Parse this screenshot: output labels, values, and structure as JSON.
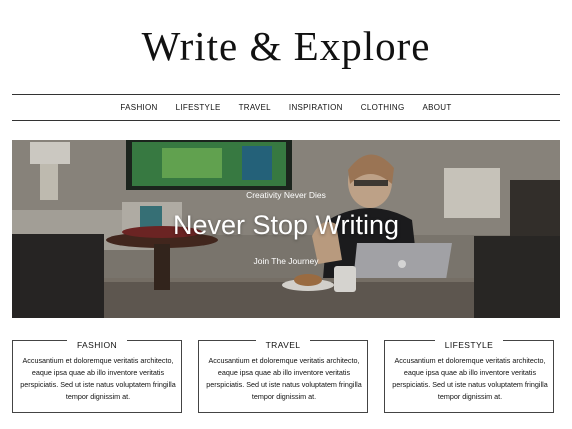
{
  "site": {
    "title": "Write & Explore"
  },
  "nav": {
    "items": [
      {
        "label": "FASHION"
      },
      {
        "label": "LIFESTYLE"
      },
      {
        "label": "TRAVEL"
      },
      {
        "label": "INSPIRATION"
      },
      {
        "label": "CLOTHING"
      },
      {
        "label": "ABOUT"
      }
    ]
  },
  "hero": {
    "kicker": "Creativity Never Dies",
    "heading": "Never Stop Writing",
    "cta": "Join The Journey"
  },
  "cards": [
    {
      "title": "FASHION",
      "text": "Accusantium et doloremque veritatis architecto, eaque ipsa quae ab illo inventore veritatis perspiciatis. Sed ut iste natus voluptatem fringilla tempor dignissim at."
    },
    {
      "title": "TRAVEL",
      "text": "Accusantium et doloremque veritatis architecto, eaque ipsa quae ab illo inventore veritatis perspiciatis. Sed ut iste natus voluptatem fringilla tempor dignissim at."
    },
    {
      "title": "LIFESTYLE",
      "text": "Accusantium et doloremque veritatis architecto, eaque ipsa quae ab illo inventore veritatis perspiciatis. Sed ut iste natus voluptatem fringilla tempor dignissim at."
    }
  ]
}
